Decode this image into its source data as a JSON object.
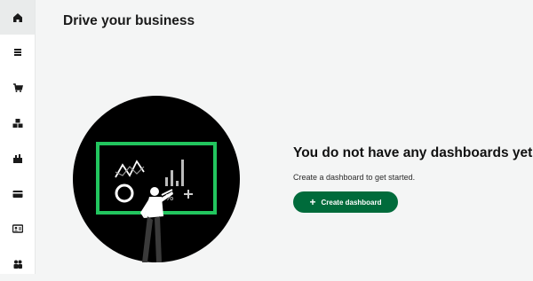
{
  "sidebar": {
    "items": [
      {
        "icon": "home-icon",
        "active": true
      },
      {
        "icon": "menu-list-icon",
        "active": false
      },
      {
        "icon": "cart-icon",
        "active": false
      },
      {
        "icon": "boxes-icon",
        "active": false
      },
      {
        "icon": "bar-chart-icon",
        "active": false
      },
      {
        "icon": "card-icon",
        "active": false
      },
      {
        "icon": "contact-card-icon",
        "active": false
      },
      {
        "icon": "users-icon",
        "active": false
      }
    ]
  },
  "header": {
    "title": "Drive your business"
  },
  "empty_state": {
    "heading": "You do not have any dashboards yet.",
    "subtext": "Create a dashboard to get started.",
    "button_label": "Create dashboard",
    "button_icon": "plus-icon",
    "illustration": "presenter-chalkboard-illustration"
  },
  "colors": {
    "accent": "#006b3b",
    "illustration_bg": "#000000",
    "board_border": "#22c55e",
    "page_bg": "#f4f5f5"
  }
}
